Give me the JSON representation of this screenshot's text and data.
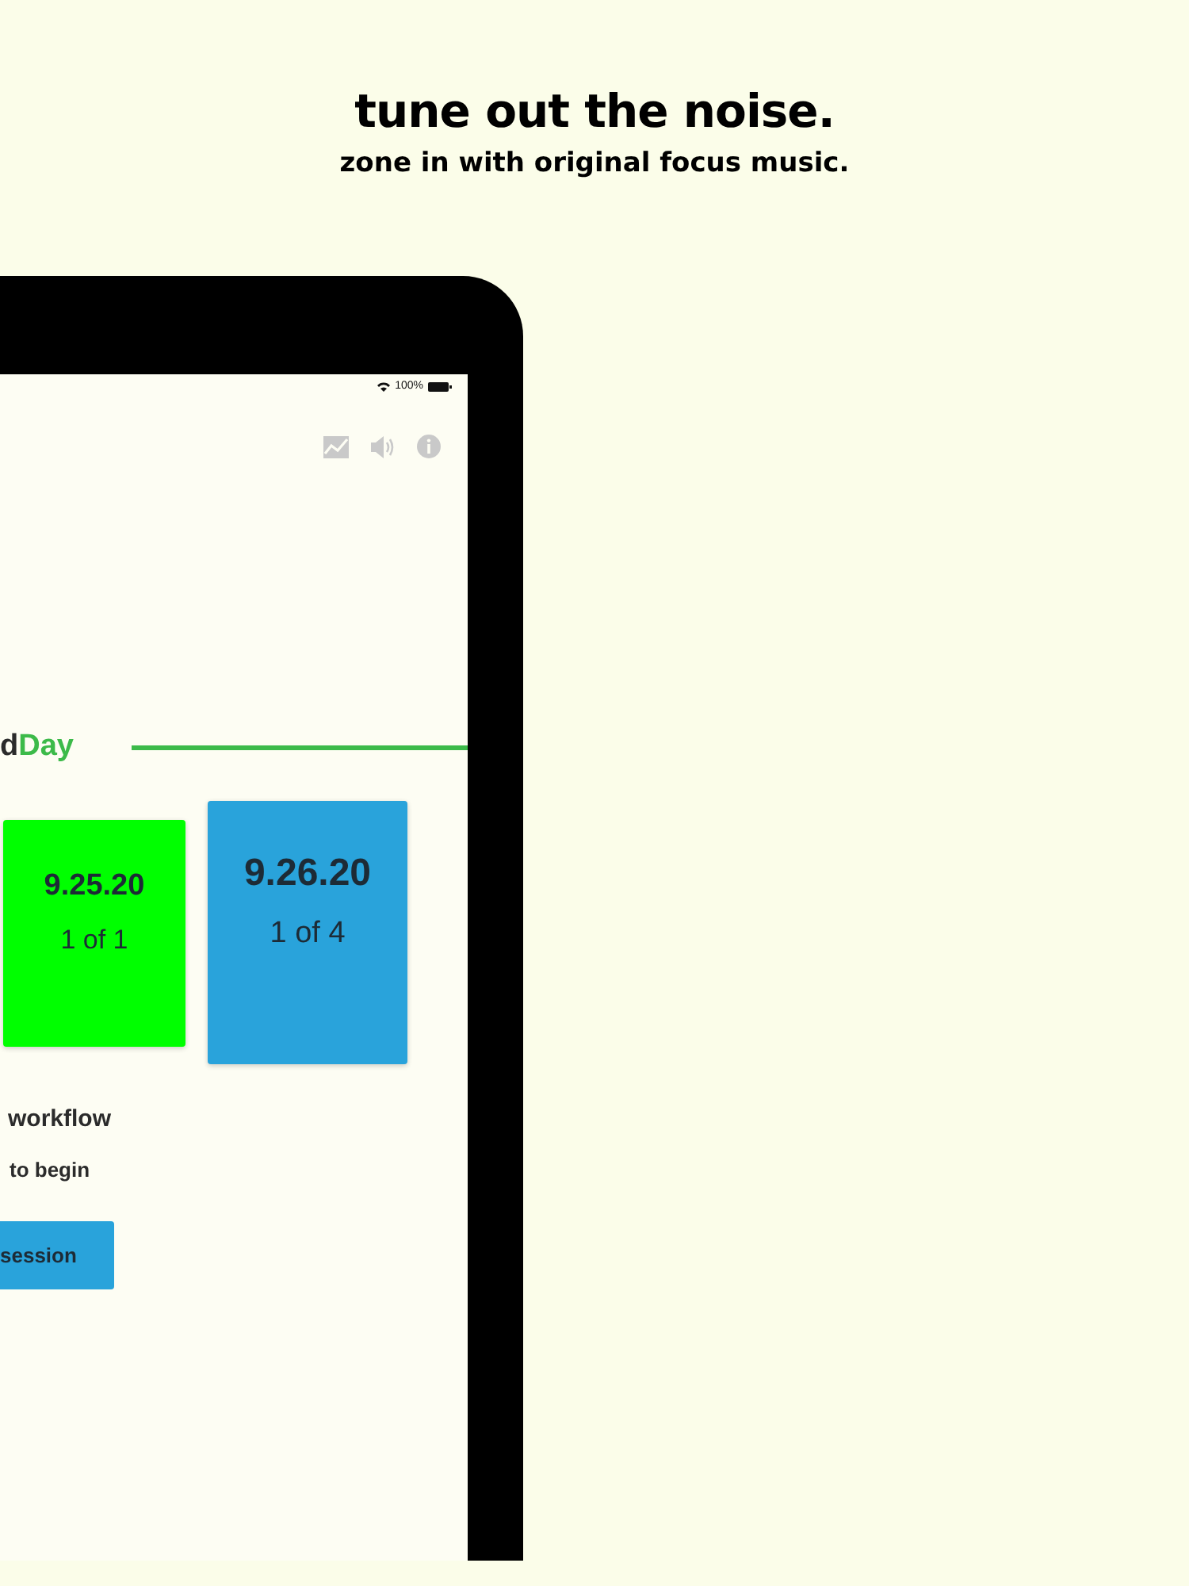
{
  "headline": "tune out the noise.",
  "subheadline": "zone in with original focus music.",
  "status_bar": {
    "battery_text": "100%"
  },
  "logo": {
    "dark": "d",
    "green": "Day"
  },
  "cards": [
    {
      "date": "9.25.20",
      "count": "1 of 1",
      "color": "#00ff00",
      "selected": false
    },
    {
      "date": "9.26.20",
      "count": "1 of 4",
      "color": "#29a3db",
      "selected": true
    }
  ],
  "workflow_title": "workflow",
  "workflow_hint": "to begin",
  "start_button": "session"
}
